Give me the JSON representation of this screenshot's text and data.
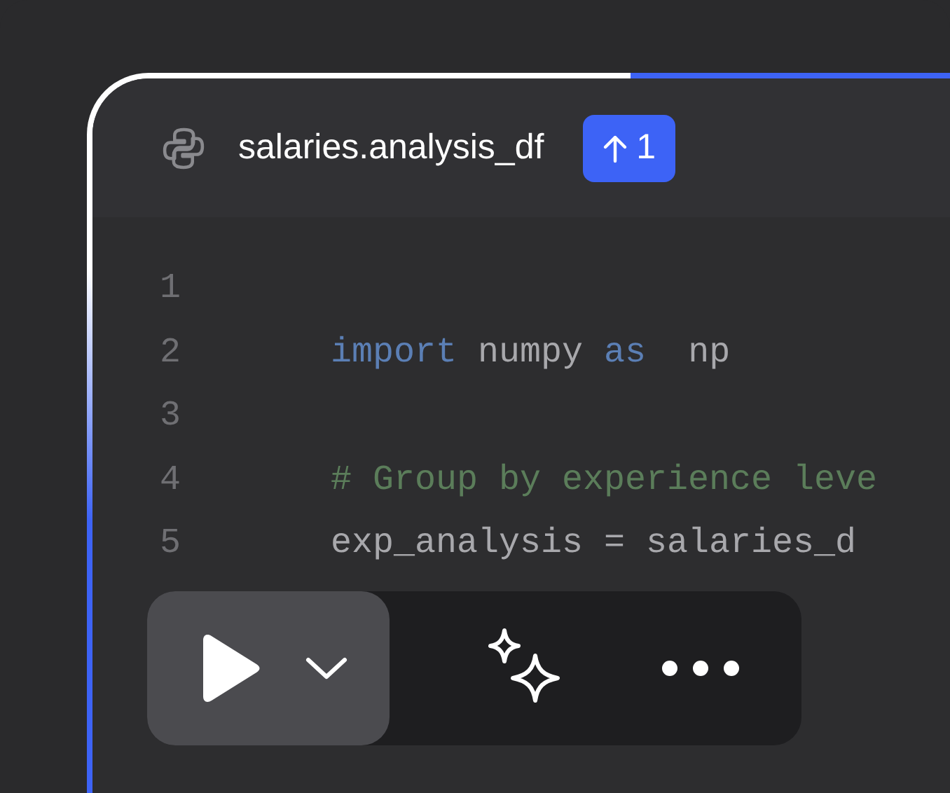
{
  "tab": {
    "title": "salaries.analysis_df",
    "badge": "1"
  },
  "code_lines": [
    {
      "number": "1"
    },
    {
      "number": "2",
      "tokens": [
        {
          "kind": "keyword",
          "text": "import"
        },
        {
          "kind": "plain",
          "text": " numpy "
        },
        {
          "kind": "keyword",
          "text": "as"
        },
        {
          "kind": "plain",
          "text": "  np"
        }
      ]
    },
    {
      "number": "3"
    },
    {
      "number": "4",
      "tokens": [
        {
          "kind": "comment",
          "text": "# Group by experience leve"
        }
      ]
    },
    {
      "number": "5",
      "tokens": [
        {
          "kind": "plain",
          "text": "exp_analysis = salaries_d"
        }
      ]
    }
  ]
}
